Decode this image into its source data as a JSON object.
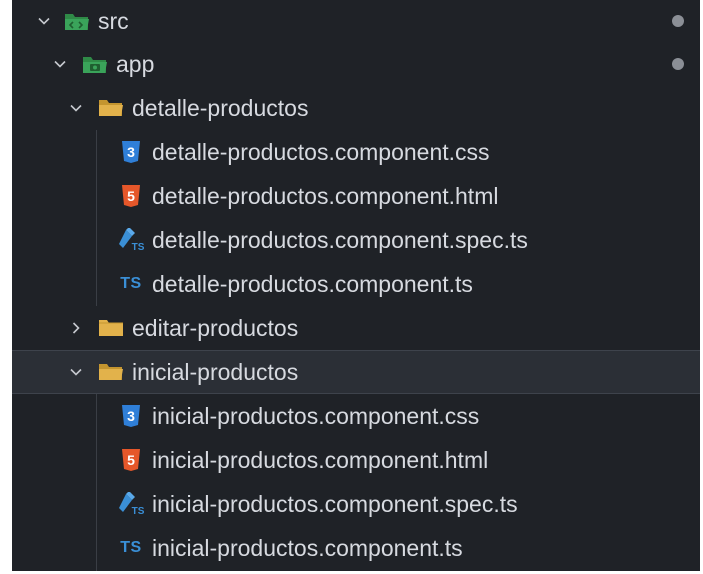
{
  "explorer": {
    "items": [
      {
        "label": "src",
        "icon": "folder-src-open-icon",
        "expanded": true,
        "modified": true
      },
      {
        "label": "app",
        "icon": "folder-app-open-icon",
        "expanded": true,
        "modified": true
      },
      {
        "label": "detalle-productos",
        "icon": "folder-open-icon",
        "expanded": true
      },
      {
        "label": "detalle-productos.component.css",
        "icon": "css-file-icon"
      },
      {
        "label": "detalle-productos.component.html",
        "icon": "html-file-icon"
      },
      {
        "label": "detalle-productos.component.spec.ts",
        "icon": "test-ts-file-icon"
      },
      {
        "label": "detalle-productos.component.ts",
        "icon": "ts-file-icon",
        "icon_text": "TS"
      },
      {
        "label": "editar-productos",
        "icon": "folder-closed-icon",
        "expanded": false
      },
      {
        "label": "inicial-productos",
        "icon": "folder-open-icon",
        "expanded": true,
        "selected": true
      },
      {
        "label": "inicial-productos.component.css",
        "icon": "css-file-icon"
      },
      {
        "label": "inicial-productos.component.html",
        "icon": "html-file-icon"
      },
      {
        "label": "inicial-productos.component.spec.ts",
        "icon": "test-ts-file-icon"
      },
      {
        "label": "inicial-productos.component.ts",
        "icon": "ts-file-icon",
        "icon_text": "TS"
      }
    ]
  },
  "colors": {
    "background": "#1f2227",
    "selected_row": "#2b2f36",
    "text": "#d7dae0",
    "folder": "#e2b24b",
    "folder_green": "#3aa35a",
    "css": "#2f7fd8",
    "html": "#e5572a",
    "ts": "#3a8fd6",
    "modified_dot": "#8b8f96"
  }
}
